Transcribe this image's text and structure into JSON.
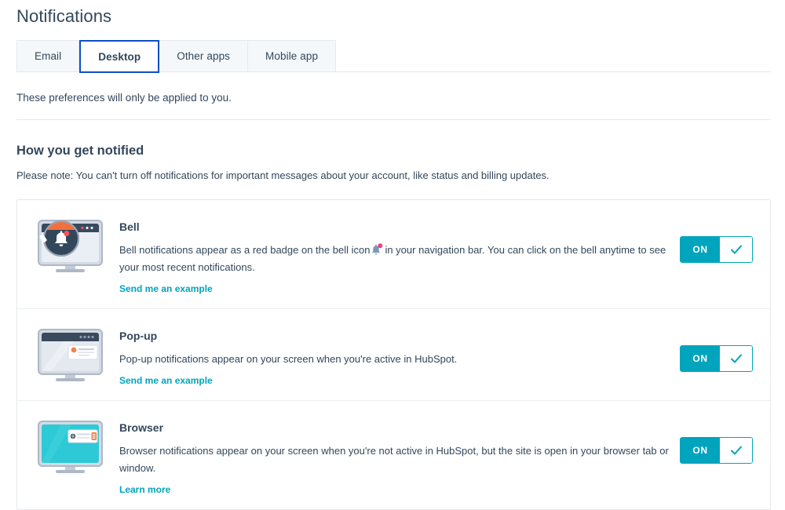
{
  "page": {
    "title": "Notifications"
  },
  "tabs": {
    "items": [
      {
        "label": "Email",
        "active": false
      },
      {
        "label": "Desktop",
        "active": true
      },
      {
        "label": "Other apps",
        "active": false
      },
      {
        "label": "Mobile app",
        "active": false
      }
    ]
  },
  "intro": {
    "note": "These preferences will only be applied to you."
  },
  "section": {
    "title": "How you get notified",
    "note": "Please note: You can't turn off notifications for important messages about your account, like status and billing updates."
  },
  "notifications": [
    {
      "name": "Bell",
      "description_before_icon": "Bell notifications appear as a red badge on the bell icon",
      "icon_name": "bell-icon",
      "description_after_icon": "in your navigation bar. You can click on the bell anytime to see your most recent notifications.",
      "link_label": "Send me an example",
      "toggle_label": "ON",
      "toggle_state": "on",
      "illustration": "monitor-bell-magnifier"
    },
    {
      "name": "Pop-up",
      "description_before_icon": "Pop-up notifications appear on your screen when you're active in HubSpot.",
      "icon_name": "",
      "description_after_icon": "",
      "link_label": "Send me an example",
      "toggle_label": "ON",
      "toggle_state": "on",
      "illustration": "monitor-popup-card"
    },
    {
      "name": "Browser",
      "description_before_icon": "Browser notifications appear on your screen when you're not active in HubSpot, but the site is open in your browser tab or window.",
      "icon_name": "",
      "description_after_icon": "",
      "link_label": "Learn more",
      "toggle_label": "ON",
      "toggle_state": "on",
      "illustration": "monitor-browser-teal"
    }
  ],
  "colors": {
    "teal": "#00a4bd",
    "active_tab_border": "#0c50c8",
    "text": "#33475b",
    "border": "#e5e9ec",
    "badge_red": "#f2545b",
    "accent_orange": "#f5814c"
  }
}
